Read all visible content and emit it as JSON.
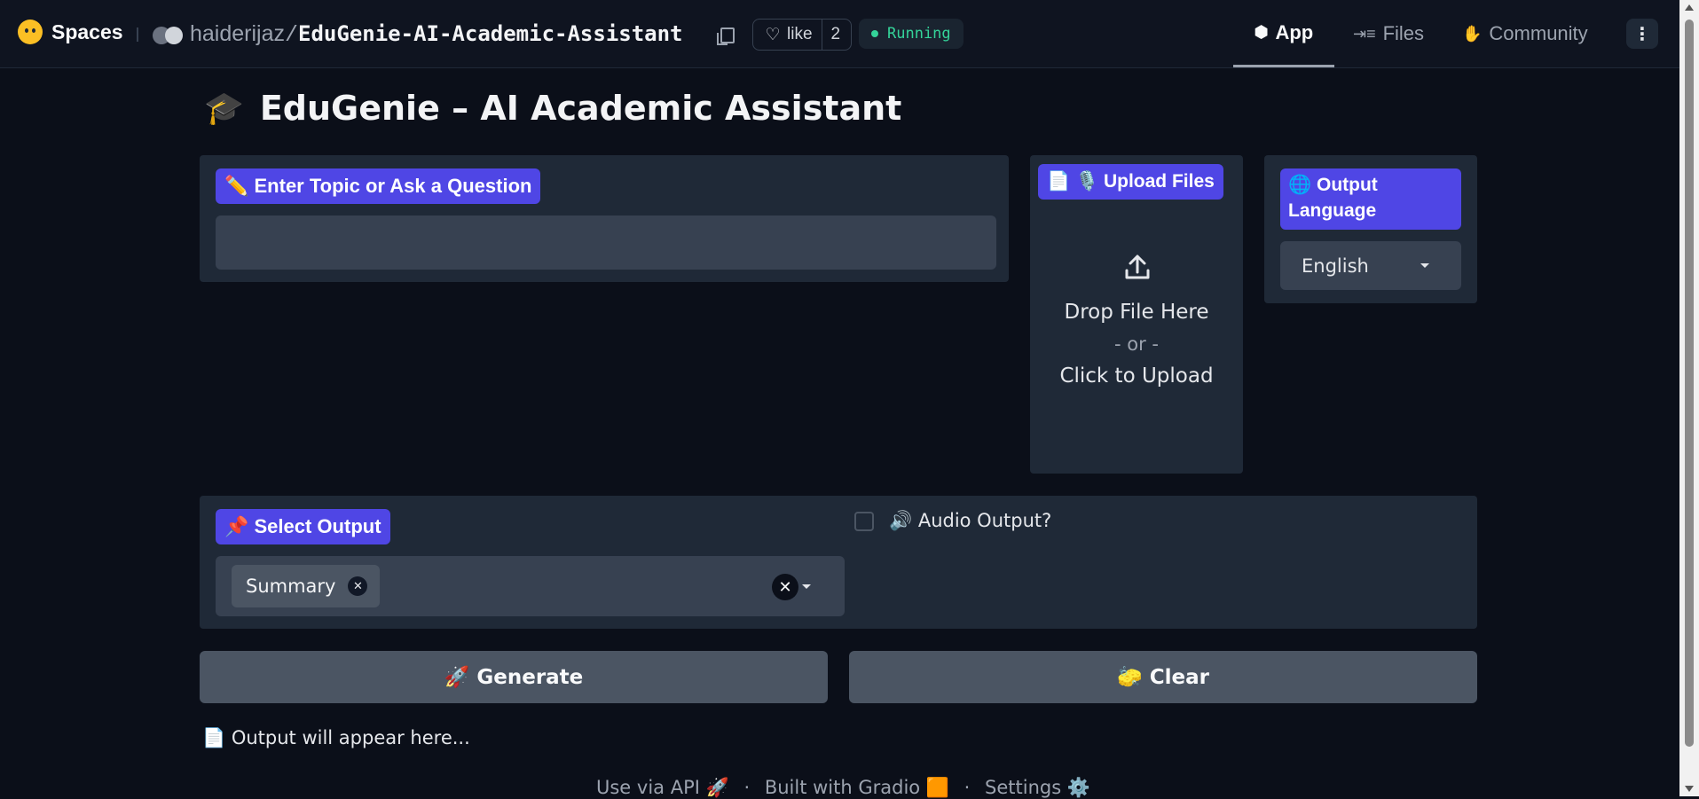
{
  "header": {
    "brand": "Spaces",
    "owner": "haiderijaz",
    "separator": "/",
    "repo_name": "EduGenie-AI-Academic-Assistant",
    "like_label": "like",
    "like_count": "2",
    "status": "Running",
    "tabs": [
      {
        "label": "App",
        "icon": "cube-icon"
      },
      {
        "label": "Files",
        "icon": "files-icon"
      },
      {
        "label": "Community",
        "icon": "community-icon"
      }
    ],
    "menu_icon": "⋮"
  },
  "app": {
    "title_emoji": "🎓",
    "title": "EduGenie – AI Academic Assistant",
    "topic": {
      "label": "✏️ Enter Topic or Ask a Question",
      "value": ""
    },
    "upload": {
      "label": "📄 🎙️ Upload Files",
      "drop_text": "Drop File Here",
      "or_text": "- or -",
      "click_text": "Click to Upload"
    },
    "language": {
      "label": "🌐 Output Language",
      "value": "English"
    },
    "select_output": {
      "label": "📌 Select Output",
      "selected": [
        "Summary"
      ]
    },
    "audio": {
      "label": "🔊 Audio Output?",
      "checked": false
    },
    "buttons": {
      "generate": "🚀 Generate",
      "clear": "🧽 Clear"
    },
    "output_placeholder": "📄 Output will appear here...",
    "footer": {
      "api": "Use via API 🚀",
      "gradio": "Built with Gradio 🟧",
      "settings": "Settings ⚙️",
      "dot": "·"
    }
  },
  "colors": {
    "accent": "#4f46e5",
    "running": "#34d399",
    "background": "#0b0f19",
    "panel": "#1f2937"
  }
}
